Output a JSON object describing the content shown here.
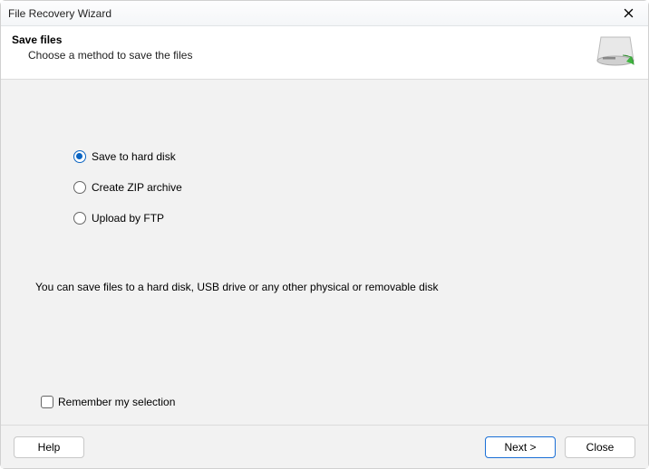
{
  "window": {
    "title": "File Recovery Wizard"
  },
  "header": {
    "title": "Save files",
    "subtitle": "Choose a method to save the files"
  },
  "options": [
    {
      "label": "Save to hard disk",
      "checked": true
    },
    {
      "label": "Create ZIP archive",
      "checked": false
    },
    {
      "label": "Upload by FTP",
      "checked": false
    }
  ],
  "description": "You can save files to a hard disk, USB drive or any other physical or removable disk",
  "remember": {
    "label": "Remember my selection",
    "checked": false
  },
  "buttons": {
    "help": "Help",
    "next": "Next >",
    "close": "Close"
  }
}
